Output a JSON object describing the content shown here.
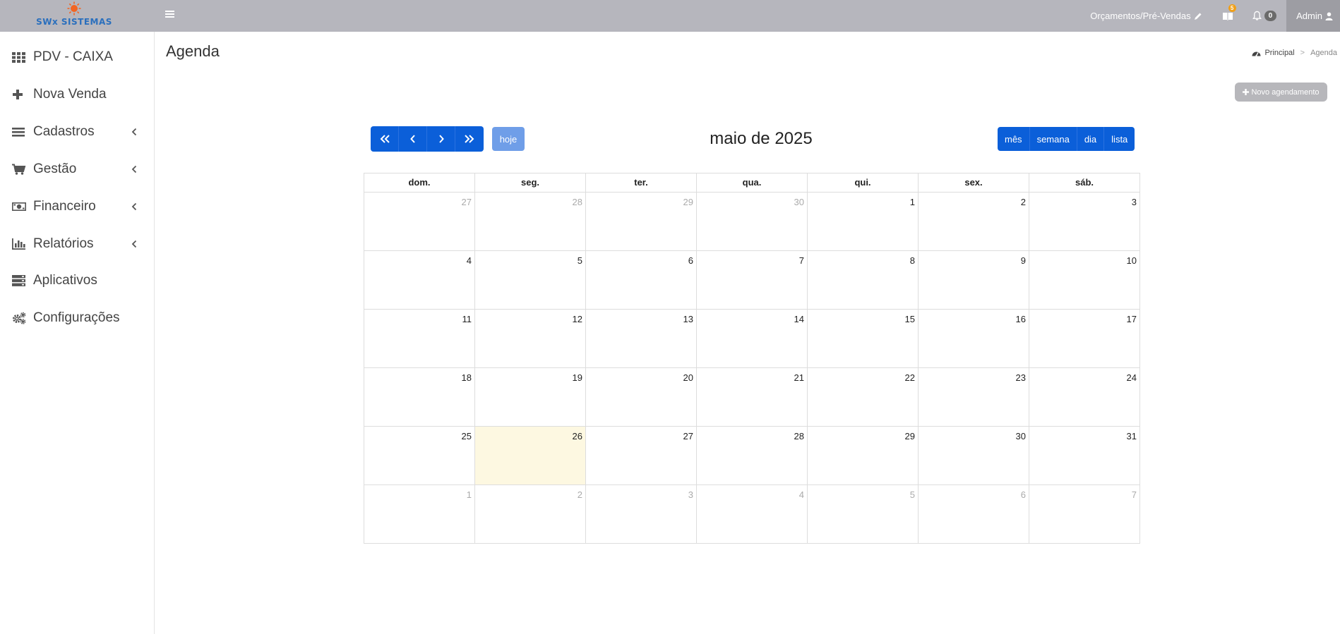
{
  "brand": {
    "name": "SWx SISTEMAS",
    "logo_color": "#2a6fbd",
    "sun_color": "#f26522"
  },
  "topbar": {
    "orcamentos": "Orçamentos/Pré-Vendas",
    "messages_badge": "5",
    "notifications_count": "0",
    "user": "Admin"
  },
  "sidebar": {
    "items": [
      {
        "label": "PDV - CAIXA",
        "icon": "grid-icon",
        "has_submenu": false
      },
      {
        "label": "Nova Venda",
        "icon": "plus-icon",
        "has_submenu": false
      },
      {
        "label": "Cadastros",
        "icon": "bars-icon",
        "has_submenu": true
      },
      {
        "label": "Gestão",
        "icon": "cart-icon",
        "has_submenu": true
      },
      {
        "label": "Financeiro",
        "icon": "money-icon",
        "has_submenu": true
      },
      {
        "label": "Relatórios",
        "icon": "bar-chart-icon",
        "has_submenu": true
      },
      {
        "label": "Aplicativos",
        "icon": "server-icon",
        "has_submenu": false
      },
      {
        "label": "Configurações",
        "icon": "cogs-icon",
        "has_submenu": false
      }
    ]
  },
  "page": {
    "title": "Agenda",
    "breadcrumb": {
      "home": "Principal",
      "current": "Agenda"
    },
    "novo_button": "Novo agendamento"
  },
  "calendar": {
    "title": "maio de 2025",
    "today_button": "hoje",
    "views": [
      "mês",
      "semana",
      "dia",
      "lista"
    ],
    "weekdays": [
      "dom.",
      "seg.",
      "ter.",
      "qua.",
      "qui.",
      "sex.",
      "sáb."
    ],
    "weeks": [
      [
        {
          "day": "27",
          "other": true
        },
        {
          "day": "28",
          "other": true
        },
        {
          "day": "29",
          "other": true
        },
        {
          "day": "30",
          "other": true
        },
        {
          "day": "1"
        },
        {
          "day": "2"
        },
        {
          "day": "3"
        }
      ],
      [
        {
          "day": "4"
        },
        {
          "day": "5"
        },
        {
          "day": "6"
        },
        {
          "day": "7"
        },
        {
          "day": "8"
        },
        {
          "day": "9"
        },
        {
          "day": "10"
        }
      ],
      [
        {
          "day": "11"
        },
        {
          "day": "12"
        },
        {
          "day": "13"
        },
        {
          "day": "14"
        },
        {
          "day": "15"
        },
        {
          "day": "16"
        },
        {
          "day": "17"
        }
      ],
      [
        {
          "day": "18"
        },
        {
          "day": "19"
        },
        {
          "day": "20"
        },
        {
          "day": "21"
        },
        {
          "day": "22"
        },
        {
          "day": "23"
        },
        {
          "day": "24"
        }
      ],
      [
        {
          "day": "25"
        },
        {
          "day": "26",
          "today": true
        },
        {
          "day": "27"
        },
        {
          "day": "28"
        },
        {
          "day": "29"
        },
        {
          "day": "30"
        },
        {
          "day": "31"
        }
      ],
      [
        {
          "day": "1",
          "other": true
        },
        {
          "day": "2",
          "other": true
        },
        {
          "day": "3",
          "other": true
        },
        {
          "day": "4",
          "other": true
        },
        {
          "day": "5",
          "other": true
        },
        {
          "day": "6",
          "other": true
        },
        {
          "day": "7",
          "other": true
        }
      ]
    ],
    "today_color": "#fdf8e1",
    "button_color": "#0b5fd9"
  }
}
